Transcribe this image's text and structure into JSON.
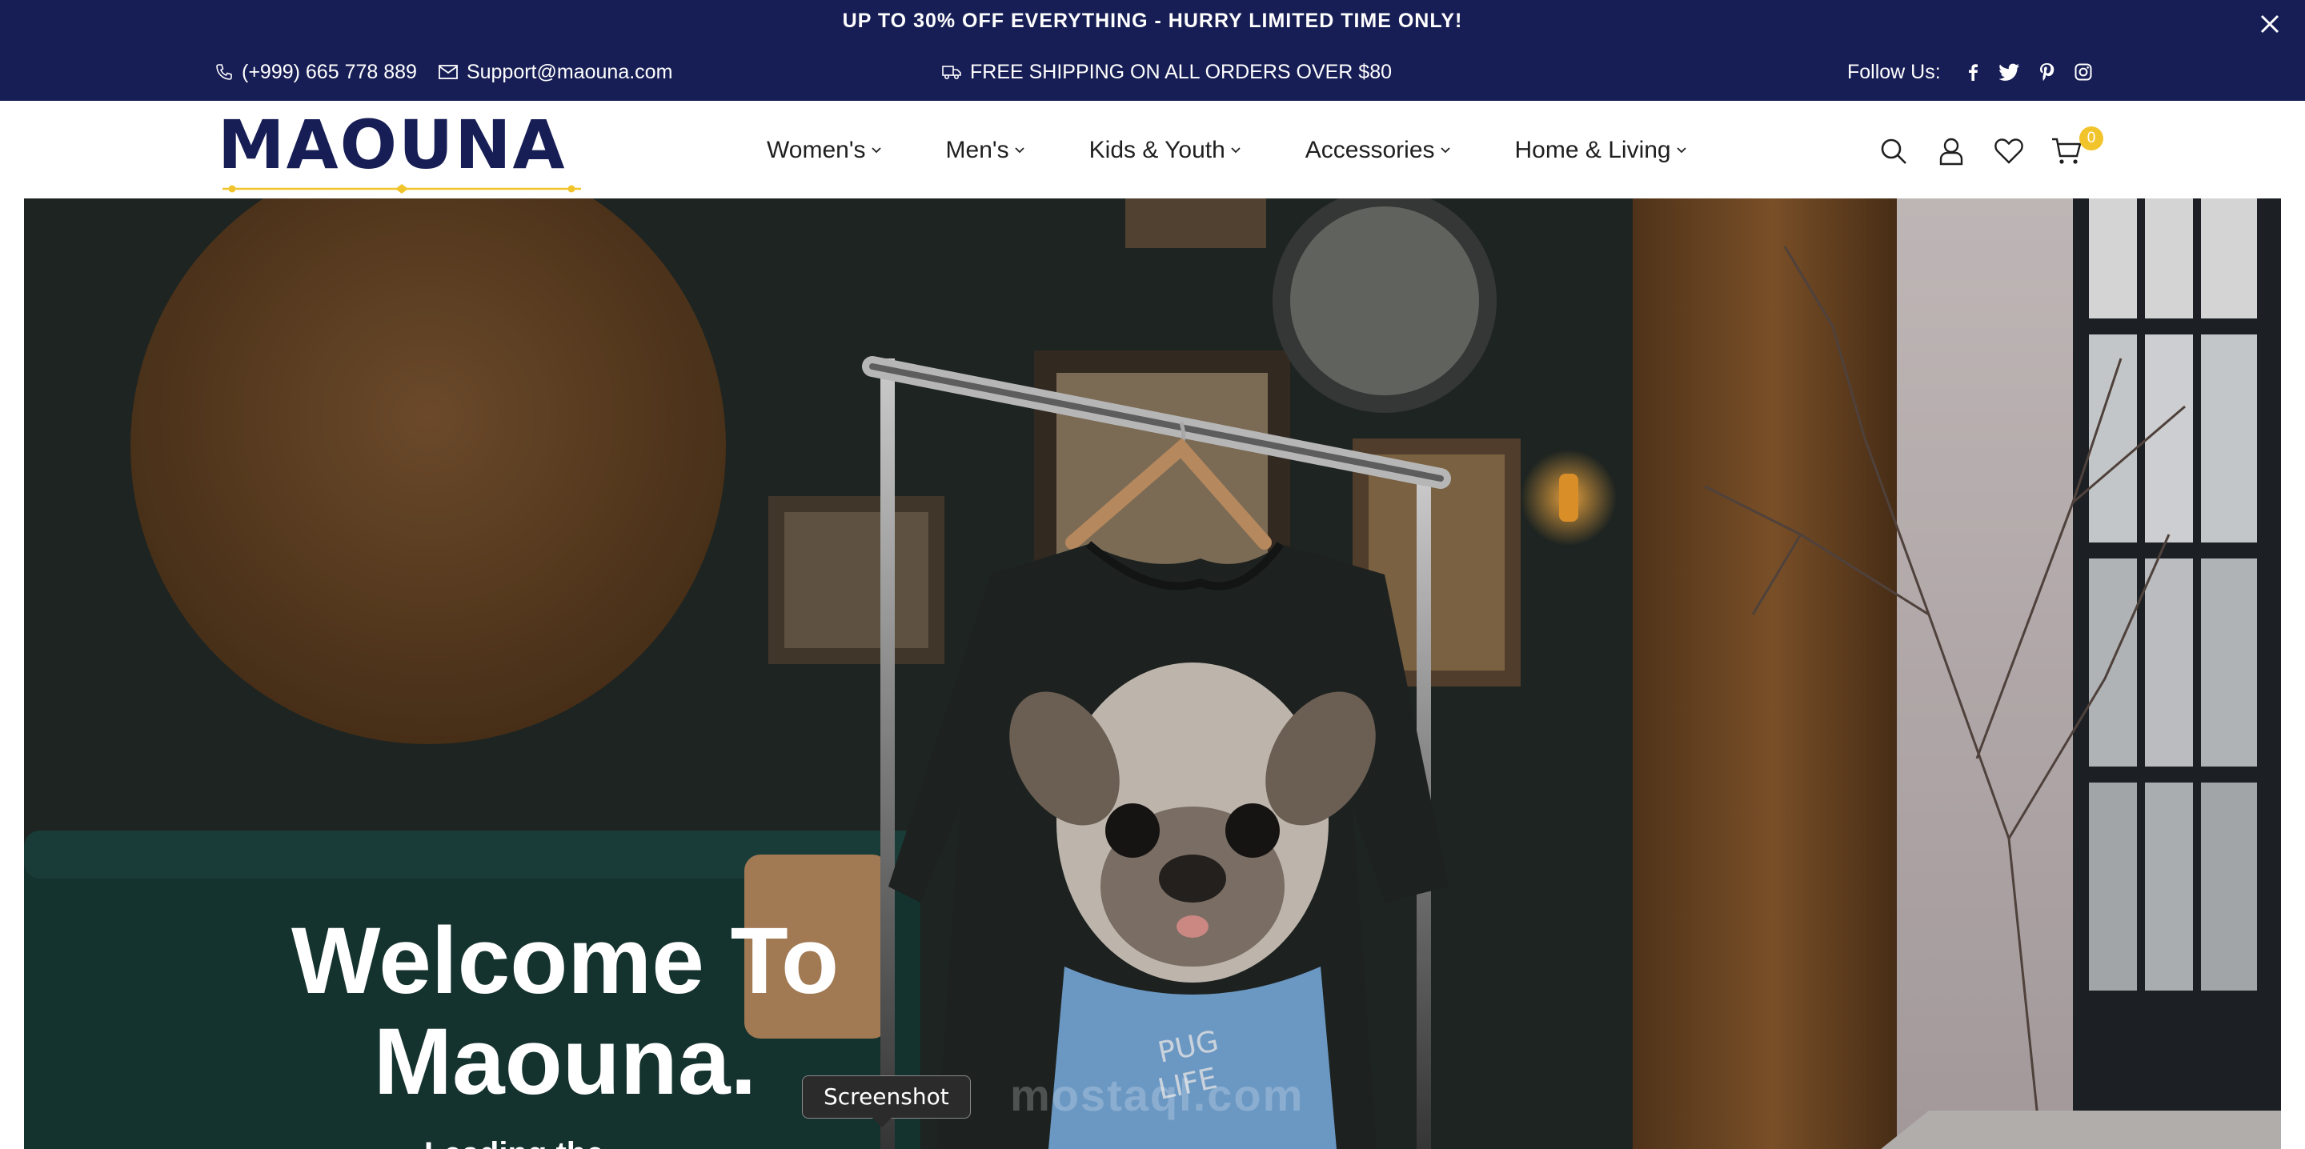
{
  "announcement": {
    "promo_text": "UP TO 30% OFF EVERYTHING - HURRY LIMITED TIME ONLY!",
    "close_icon": "close-icon"
  },
  "topbar": {
    "phone": "(+999) 665 778 889",
    "email": "Support@maouna.com",
    "shipping": "FREE SHIPPING ON ALL ORDERS OVER $80",
    "follow_label": "Follow Us:",
    "social_icons": [
      "facebook-icon",
      "twitter-icon",
      "pinterest-icon",
      "instagram-icon"
    ]
  },
  "header": {
    "logo_text": "MAOUNA",
    "nav": [
      {
        "label": "Women's"
      },
      {
        "label": "Men's"
      },
      {
        "label": "Kids & Youth"
      },
      {
        "label": "Accessories"
      },
      {
        "label": "Home & Living"
      }
    ],
    "tools": [
      "search-icon",
      "account-icon",
      "wishlist-icon",
      "cart-icon"
    ],
    "cart_count": "0"
  },
  "hero": {
    "title_line1": "Welcome To",
    "title_line2": "Maouna.",
    "subtitle": "Leading the Way in Home",
    "watermark": "mostaql.com",
    "shirt_text_1": "PUG",
    "shirt_text_2": "LIFE"
  },
  "tooltip": {
    "label": "Screenshot"
  },
  "colors": {
    "topbar_bg": "#171e55",
    "brand_navy": "#171e55",
    "brand_gold": "#f2c42c",
    "text_dark": "#1f1f1f"
  }
}
